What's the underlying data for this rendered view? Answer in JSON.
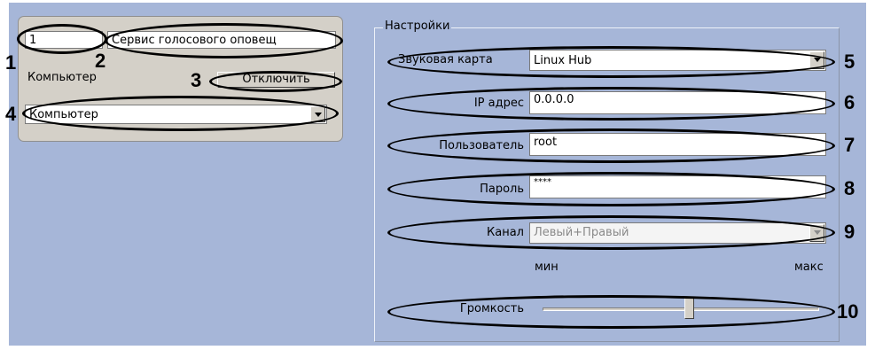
{
  "object_panel": {
    "id_value": "1",
    "name_value": "Сервис голосового оповещ",
    "computer_label": "Компьютер",
    "disable_button": "Отключить",
    "computer_select": "Компьютер"
  },
  "settings": {
    "group_title": "Настройки",
    "sound_card": {
      "label": "Звуковая карта",
      "value": "Linux Hub"
    },
    "ip": {
      "label": "IP адрес",
      "value": "0.0.0.0"
    },
    "user": {
      "label": "Пользователь",
      "value": "root"
    },
    "password": {
      "label": "Пароль",
      "value": "****"
    },
    "channel": {
      "label": "Канал",
      "value": "Левый+Правый",
      "disabled": true
    },
    "volume": {
      "label": "Громкость",
      "min_label": "мин",
      "max_label": "макс",
      "level_fraction": 0.53
    }
  },
  "callouts": [
    "1",
    "2",
    "3",
    "4",
    "5",
    "6",
    "7",
    "8",
    "9",
    "10"
  ],
  "colors": {
    "background": "#a6b6d8",
    "panel": "#d4d0c8",
    "callout": "#000000"
  }
}
